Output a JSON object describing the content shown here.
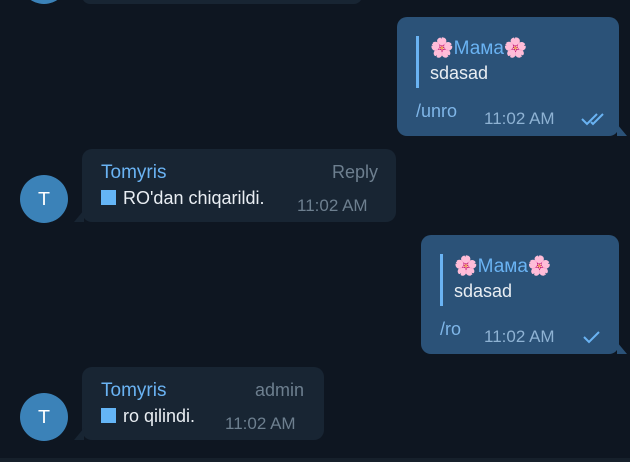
{
  "messages": [
    {
      "reply_name": "Мама",
      "reply_flower_left": "🌸",
      "reply_flower_right": "🌸",
      "reply_text": "sdasad",
      "command": "/unro",
      "time": "11:02 AM",
      "status": "read-double-check"
    },
    {
      "sender": "Tomyris",
      "avatar_letter": "T",
      "tag": "Reply",
      "text": "RO'dan chiqarildi.",
      "time": "11:02 AM"
    },
    {
      "reply_name": "Мама",
      "reply_flower_left": "🌸",
      "reply_flower_right": "🌸",
      "reply_text": "sdasad",
      "command": "/ro",
      "time": "11:02 AM",
      "status": "sent-single-check"
    },
    {
      "sender": "Tomyris",
      "avatar_letter": "T",
      "tag": "admin",
      "text": "ro qilindi.",
      "time": "11:02 AM"
    }
  ],
  "colors": {
    "background": "#0e1621",
    "outgoing_bubble": "#2b5278",
    "incoming_bubble": "#182533",
    "accent": "#6ab3f3",
    "avatar": "#3b82b8",
    "square_bullet": "#64b5f6"
  }
}
